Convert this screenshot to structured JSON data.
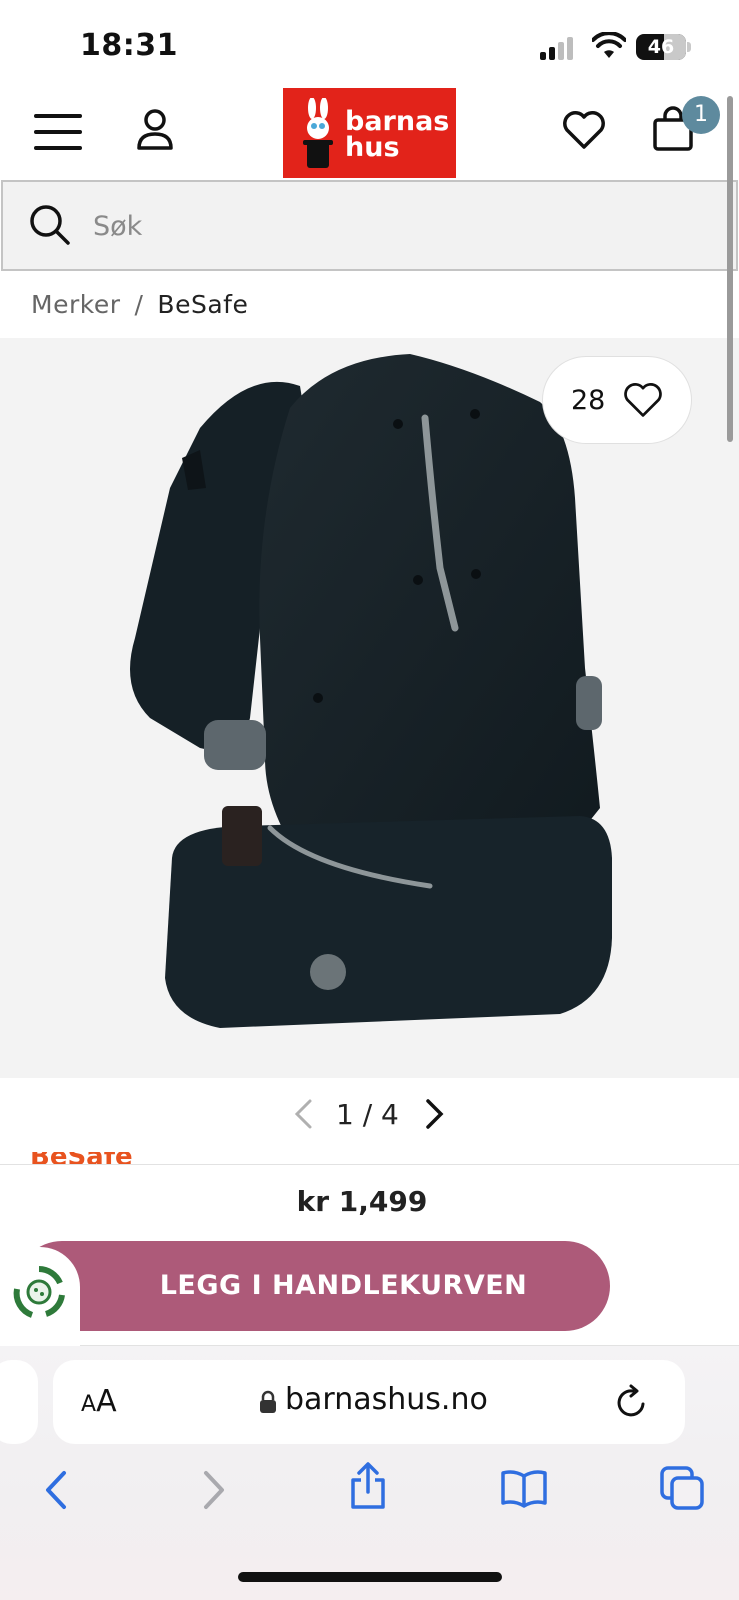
{
  "status_bar": {
    "time": "18:31",
    "battery_percent": "46",
    "icons": [
      "cellular-signal-icon",
      "wifi-icon",
      "battery-icon"
    ]
  },
  "header": {
    "logo_line1": "barnas",
    "logo_line2": "hus",
    "cart_count": "1",
    "icons": [
      "hamburger-menu-icon",
      "user-account-icon",
      "heart-icon",
      "shopping-bag-icon"
    ],
    "logo_color": "#e2231a",
    "badge_color": "#5e8a9e"
  },
  "search": {
    "placeholder": "Søk",
    "value": ""
  },
  "breadcrumb": {
    "items": [
      "Merker",
      "BeSafe"
    ],
    "separator": "/"
  },
  "product": {
    "image_alt": "BeSafe baby carrier",
    "favorites_count": "28"
  },
  "pager": {
    "text": "1 / 4"
  },
  "brand_peek": "BeSafe",
  "buy_bar": {
    "price": "kr 1,499",
    "add_to_cart_label": "LEGG I HANDLEKURVEN",
    "button_color": "#ad5a79"
  },
  "browser": {
    "aa_small": "A",
    "aa_large": "A",
    "url": "barnashus.no",
    "icons": [
      "lock-icon",
      "reload-icon",
      "back-icon",
      "forward-icon",
      "share-icon",
      "bookmarks-icon",
      "tabs-icon"
    ],
    "accent_color": "#2f6ee0"
  }
}
